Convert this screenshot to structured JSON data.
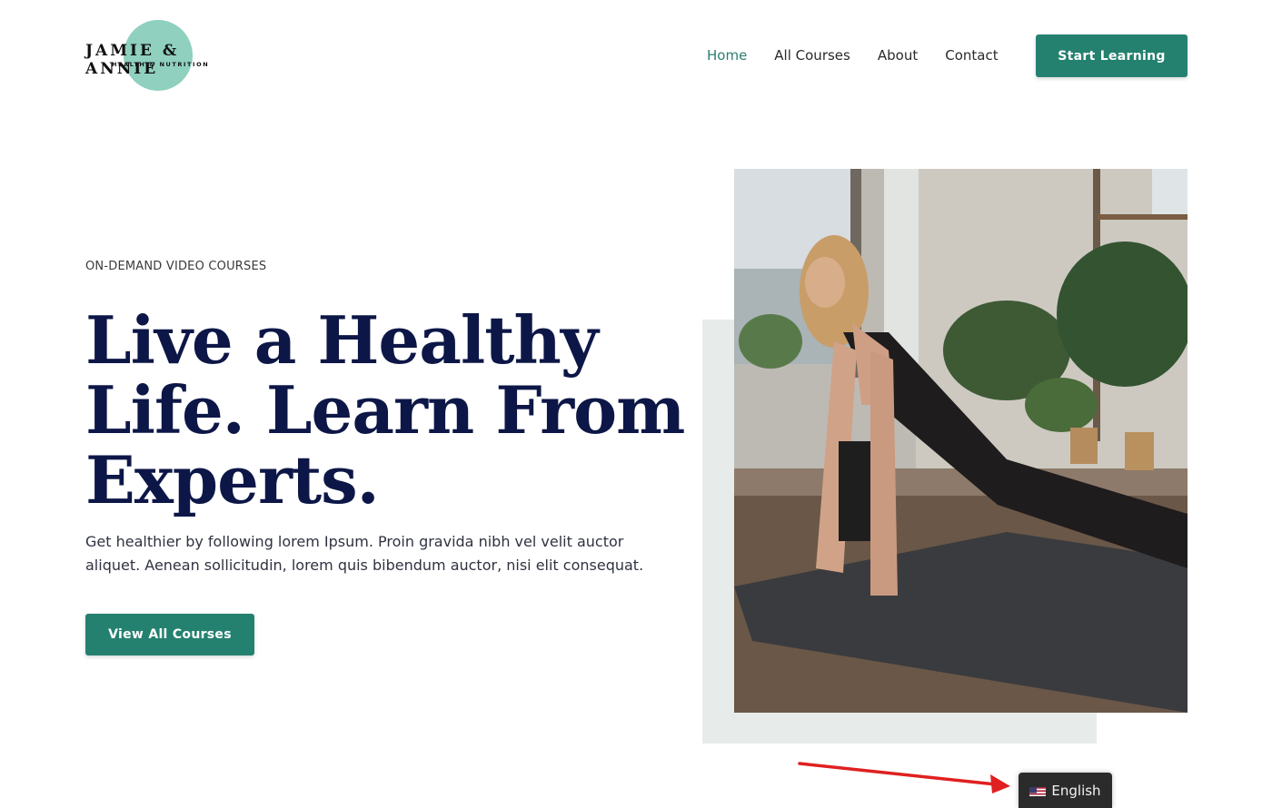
{
  "brand": {
    "name": "JAMIE & ANNIE",
    "tagline": "HEALTH & NUTRITION",
    "accent_color": "#24816f",
    "logo_blob_color": "#8fd0be"
  },
  "nav": {
    "items": [
      {
        "label": "Home",
        "active": true
      },
      {
        "label": "All Courses",
        "active": false
      },
      {
        "label": "About",
        "active": false
      },
      {
        "label": "Contact",
        "active": false
      }
    ],
    "cta_label": "Start Learning"
  },
  "hero": {
    "eyebrow": "ON-DEMAND VIDEO COURSES",
    "headline": "Live a Healthy Life. Learn From Experts.",
    "description": "Get healthier by following lorem Ipsum. Proin gravida nibh vel velit auctor aliquet. Aenean sollicitudin, lorem quis bibendum auctor, nisi elit consequat.",
    "button_label": "View All Courses",
    "headline_color": "#0d1747"
  },
  "language_switcher": {
    "label": "English",
    "flag_icon": "us-flag-icon"
  },
  "annotation": {
    "arrow_color": "#e02020",
    "arrow_icon": "red-arrow-icon"
  }
}
